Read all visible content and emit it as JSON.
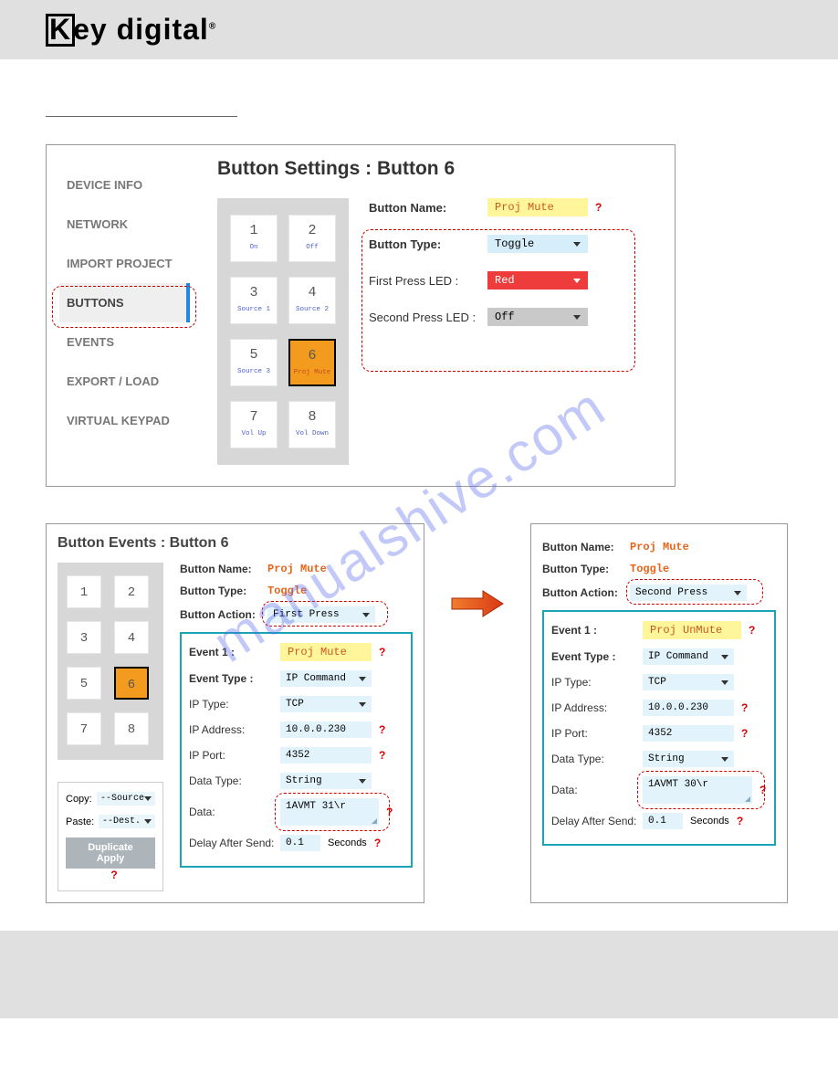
{
  "logo_text": "Key digital",
  "sidebar": [
    {
      "label": "DEVICE INFO"
    },
    {
      "label": "NETWORK"
    },
    {
      "label": "IMPORT PROJECT"
    },
    {
      "label": "BUTTONS"
    },
    {
      "label": "EVENTS"
    },
    {
      "label": "EXPORT / LOAD"
    },
    {
      "label": "VIRTUAL KEYPAD"
    }
  ],
  "panel1": {
    "title": "Button Settings : Button 6",
    "keys": [
      {
        "num": "1",
        "lbl": "On"
      },
      {
        "num": "2",
        "lbl": "Off"
      },
      {
        "num": "3",
        "lbl": "Source 1"
      },
      {
        "num": "4",
        "lbl": "Source 2"
      },
      {
        "num": "5",
        "lbl": "Source 3"
      },
      {
        "num": "6",
        "lbl": "Proj Mute"
      },
      {
        "num": "7",
        "lbl": "Vol Up"
      },
      {
        "num": "8",
        "lbl": "Vol Down"
      }
    ],
    "settings": {
      "name_label": "Button Name:",
      "name_value": "Proj Mute",
      "type_label": "Button Type:",
      "type_value": "Toggle",
      "led1_label": "First Press LED :",
      "led1_value": "Red",
      "led2_label": "Second Press LED :",
      "led2_value": "Off"
    }
  },
  "panel2a": {
    "title": "Button Events : Button 6",
    "keys": [
      "1",
      "2",
      "3",
      "4",
      "5",
      "6",
      "7",
      "8"
    ],
    "copy_label": "Copy:",
    "copy_value": "--Source",
    "paste_label": "Paste:",
    "paste_value": "--Dest.",
    "dup_label": "Duplicate Apply",
    "name_label": "Button Name:",
    "name_value": "Proj Mute",
    "type_label": "Button Type:",
    "type_value": "Toggle",
    "action_label": "Button Action:",
    "action_value": "First Press",
    "event": {
      "e1_label": "Event 1 :",
      "e1_value": "Proj Mute",
      "etype_label": "Event Type :",
      "etype_value": "IP Command",
      "iptype_label": "IP Type:",
      "iptype_value": "TCP",
      "ipaddr_label": "IP Address:",
      "ipaddr_value": "10.0.0.230",
      "ipport_label": "IP Port:",
      "ipport_value": "4352",
      "dtype_label": "Data Type:",
      "dtype_value": "String",
      "data_label": "Data:",
      "data_value": "1AVMT 31\\r",
      "delay_label": "Delay After Send:",
      "delay_value": "0.1",
      "delay_unit": "Seconds"
    }
  },
  "panel2b": {
    "name_label": "Button Name:",
    "name_value": "Proj Mute",
    "type_label": "Button Type:",
    "type_value": "Toggle",
    "action_label": "Button Action:",
    "action_value": "Second Press",
    "event": {
      "e1_label": "Event 1 :",
      "e1_value": "Proj UnMute",
      "etype_label": "Event Type :",
      "etype_value": "IP Command",
      "iptype_label": "IP Type:",
      "iptype_value": "TCP",
      "ipaddr_label": "IP Address:",
      "ipaddr_value": "10.0.0.230",
      "ipport_label": "IP Port:",
      "ipport_value": "4352",
      "dtype_label": "Data Type:",
      "dtype_value": "String",
      "data_label": "Data:",
      "data_value": "1AVMT 30\\r",
      "delay_label": "Delay After Send:",
      "delay_value": "0.1",
      "delay_unit": "Seconds"
    }
  },
  "watermark": "manualshive.com",
  "q": "?"
}
